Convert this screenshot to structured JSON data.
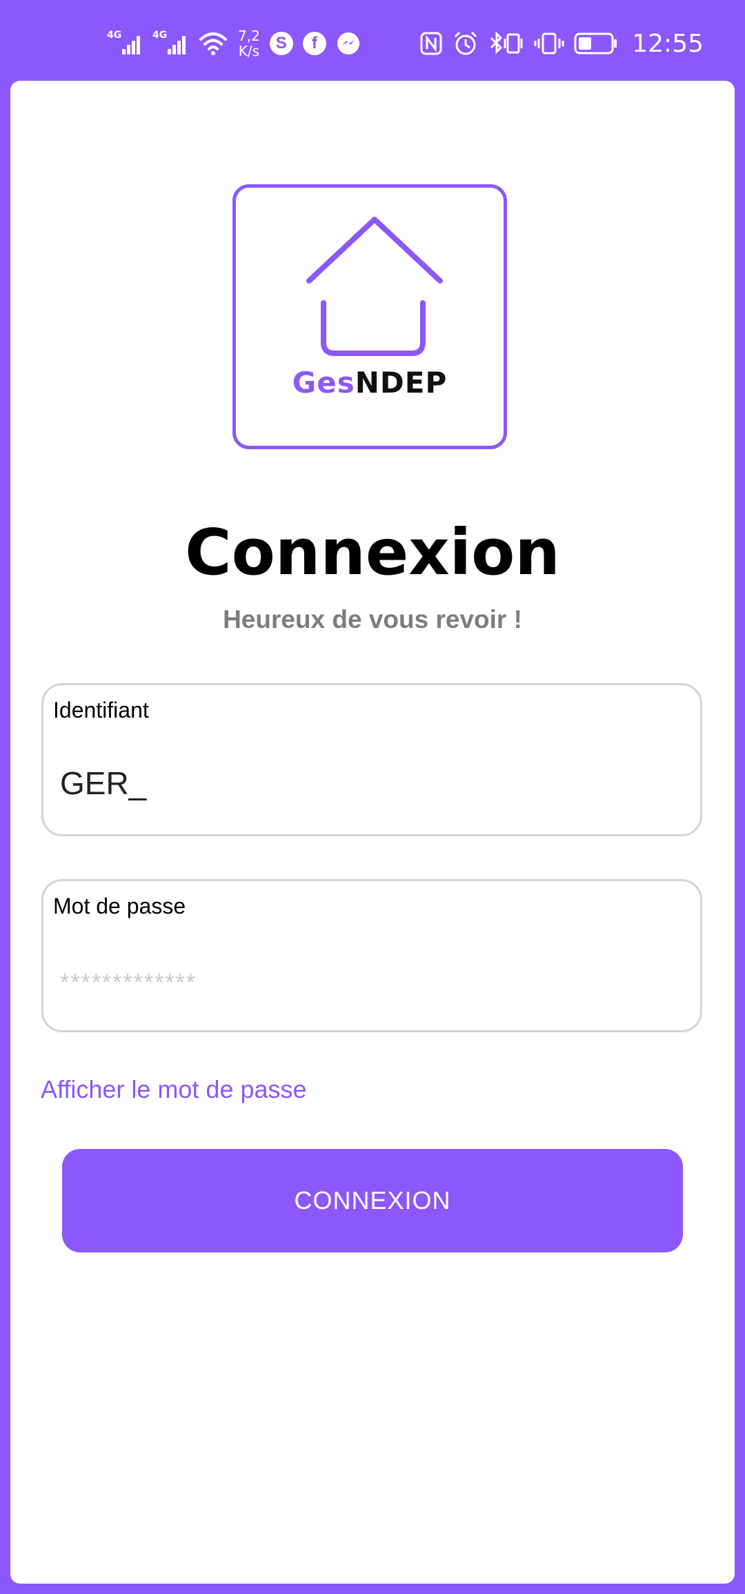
{
  "status_bar": {
    "sim1_type": "4G",
    "sim2_type": "4G",
    "net_speed_value": "7,2",
    "net_speed_unit": "K/s",
    "time": "12:55",
    "icons": [
      "signal-icon",
      "wifi-icon",
      "skype-icon",
      "facebook-icon",
      "messenger-icon",
      "nfc-icon",
      "alarm-icon",
      "bluetooth-icon",
      "vibrate-icon",
      "battery-icon"
    ]
  },
  "logo": {
    "word_part1": "Ges",
    "word_part2": "NDEP"
  },
  "login": {
    "title": "Connexion",
    "subtitle": "Heureux de vous revoir !",
    "username_label": "Identifiant",
    "username_value": "GER_",
    "password_label": "Mot de passe",
    "password_placeholder": "*************",
    "show_password_label": "Afficher le mot de passe",
    "submit_label": "CONNEXION"
  },
  "colors": {
    "accent": "#8c57fb",
    "subtitle": "#7d7d7d",
    "field_border": "#d3d3d3"
  }
}
